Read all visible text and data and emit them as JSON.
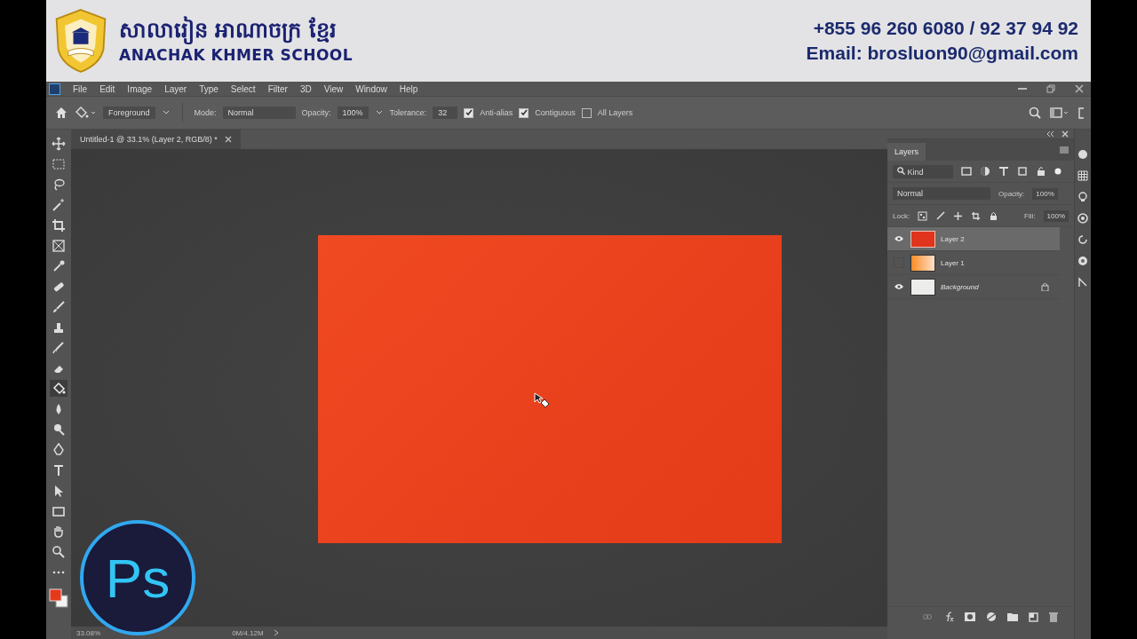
{
  "banner": {
    "school_name_khmer": "សាលារៀន អាណាចក្រ ខ្មែរ",
    "school_name": "ANACHAK KHMER SCHOOL",
    "phone": "+855 96 260 6080 / 92 37 94 92",
    "email": "Email: brosluon90@gmail.com"
  },
  "menu": [
    "File",
    "Edit",
    "Image",
    "Layer",
    "Type",
    "Select",
    "Filter",
    "3D",
    "View",
    "Window",
    "Help"
  ],
  "options_bar": {
    "fill_source": "Foreground",
    "mode_label": "Mode:",
    "mode": "Normal",
    "opacity_label": "Opacity:",
    "opacity": "100%",
    "tolerance_label": "Tolerance:",
    "tolerance": "32",
    "toggles": [
      {
        "label": "Anti-alias",
        "checked": true
      },
      {
        "label": "Contiguous",
        "checked": true
      },
      {
        "label": "All Layers",
        "checked": false
      }
    ]
  },
  "document_tab": {
    "title": "Untitled-1 @ 33.1% (Layer 2, RGB/8) *"
  },
  "tools": [
    {
      "kind": "move",
      "selected": false
    },
    {
      "kind": "marquee",
      "selected": false
    },
    {
      "kind": "lasso",
      "selected": false
    },
    {
      "kind": "wand",
      "selected": false
    },
    {
      "kind": "crop",
      "selected": false
    },
    {
      "kind": "frame",
      "selected": false
    },
    {
      "kind": "eyedropper",
      "selected": false
    },
    {
      "kind": "healing",
      "selected": false
    },
    {
      "kind": "brush",
      "selected": false
    },
    {
      "kind": "stamp",
      "selected": false
    },
    {
      "kind": "history",
      "selected": false
    },
    {
      "kind": "eraser",
      "selected": false
    },
    {
      "kind": "bucket",
      "selected": true
    },
    {
      "kind": "blur",
      "selected": false
    },
    {
      "kind": "dodge",
      "selected": false
    },
    {
      "kind": "pen",
      "selected": false
    },
    {
      "kind": "type",
      "selected": false
    },
    {
      "kind": "select",
      "selected": false
    },
    {
      "kind": "rectangle",
      "selected": false
    },
    {
      "kind": "hand",
      "selected": false
    },
    {
      "kind": "zoom",
      "selected": false
    },
    {
      "kind": "more",
      "selected": false
    }
  ],
  "layers_panel": {
    "tab": "Layers",
    "filter": "Kind",
    "blend_mode": "Normal",
    "opacity_label": "Opacity:",
    "opacity": "100%",
    "lock_label": "Lock:",
    "fill_label": "Fill:",
    "fill": "100%",
    "layers": [
      {
        "name": "Layer 2",
        "kind": "solid",
        "visible": true,
        "selected": true,
        "locked": false
      },
      {
        "name": "Layer 1",
        "kind": "gradient",
        "visible": false,
        "selected": false,
        "locked": false
      },
      {
        "name": "Background",
        "kind": "background",
        "visible": true,
        "selected": false,
        "locked": true
      }
    ]
  },
  "status_bar": {
    "zoom": "33.08%",
    "doc_size": "0M/4.12M"
  },
  "logo": {
    "text": "Ps"
  }
}
